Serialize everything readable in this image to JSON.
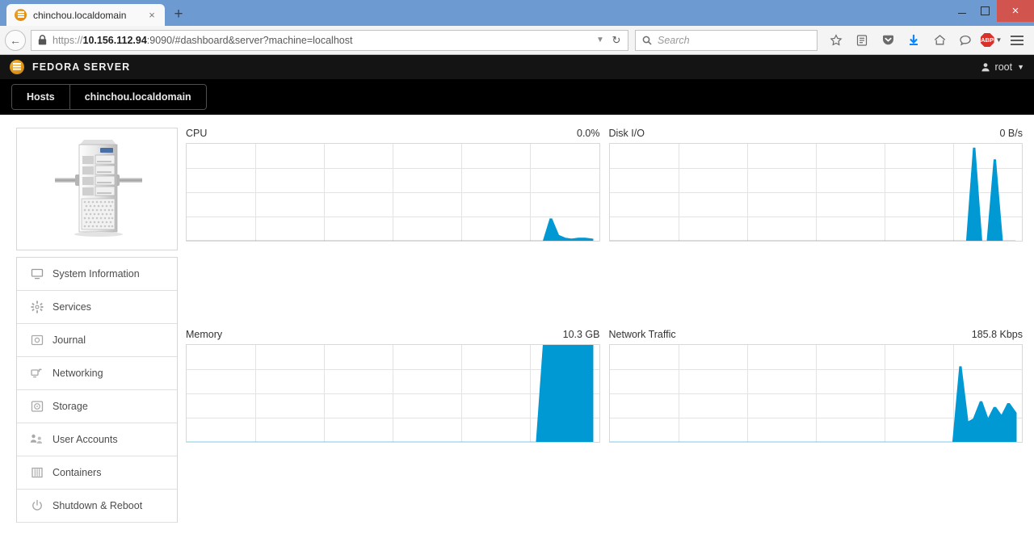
{
  "browser": {
    "tab": {
      "title": "chinchou.localdomain",
      "favicon": "fedora-icon",
      "close_label": "×"
    },
    "newtab_label": "+",
    "window_controls": {
      "minimize": "minimize-icon",
      "maximize": "restore-icon",
      "close": "×"
    },
    "url": {
      "scheme": "https://",
      "host": "10.156.112.94",
      "rest": ":9090/#dashboard&server?machine=localhost",
      "full": "https://10.156.112.94:9090/#dashboard&server?machine=localhost"
    },
    "search": {
      "placeholder": "Search"
    },
    "toolbar_icons": [
      "bookmark-star-icon",
      "reader-list-icon",
      "pocket-icon",
      "download-icon",
      "home-icon",
      "sync-chat-icon",
      "adblock-plus-icon",
      "menu-icon"
    ],
    "adblock_label": "ABP"
  },
  "app": {
    "brand": "FEDORA SERVER",
    "user": "root",
    "nav_tabs": [
      {
        "label": "Hosts"
      },
      {
        "label": "chinchou.localdomain"
      }
    ],
    "sidebar": {
      "image_name": "server-tower-illustration",
      "items": [
        {
          "label": "System Information",
          "icon": "monitor-icon"
        },
        {
          "label": "Services",
          "icon": "gear-icon"
        },
        {
          "label": "Journal",
          "icon": "journal-icon"
        },
        {
          "label": "Networking",
          "icon": "network-icon"
        },
        {
          "label": "Storage",
          "icon": "storage-disk-icon"
        },
        {
          "label": "User Accounts",
          "icon": "users-icon"
        },
        {
          "label": "Containers",
          "icon": "containers-icon"
        },
        {
          "label": "Shutdown & Reboot",
          "icon": "power-icon"
        }
      ]
    },
    "charts": [
      {
        "title": "CPU",
        "value": "0.0%"
      },
      {
        "title": "Disk I/O",
        "value": "0 B/s"
      },
      {
        "title": "Memory",
        "value": "10.3 GB"
      },
      {
        "title": "Network Traffic",
        "value": "185.8 Kbps"
      }
    ]
  },
  "colors": {
    "accent_blue": "#0099d3",
    "chart_line": "#3eaede",
    "header_black": "#141414",
    "titlebar_blue": "#6d9bd1",
    "close_red": "#d2544e"
  },
  "chart_data": [
    {
      "type": "area",
      "title": "CPU",
      "value_label": "0.0%",
      "ylabel": "",
      "xlabel": "",
      "grid": {
        "rows": 4,
        "cols": 6
      },
      "ylim": [
        0,
        100
      ],
      "x": [
        0,
        1,
        2,
        3,
        4,
        5,
        6,
        7,
        8,
        9,
        10,
        11,
        12,
        13,
        14,
        15,
        16,
        17,
        18,
        19,
        20,
        21,
        22,
        23,
        24,
        25,
        26,
        27,
        28,
        29,
        30,
        31,
        32,
        33,
        34,
        35,
        36,
        37,
        38,
        39,
        40,
        41,
        42,
        43,
        44,
        45,
        46,
        47,
        48,
        49,
        50,
        51,
        52,
        53,
        54,
        55,
        56,
        57,
        58,
        59
      ],
      "values": [
        0,
        0,
        0,
        0,
        0,
        0,
        0,
        0,
        0,
        0,
        0,
        0,
        0,
        0,
        0,
        0,
        0,
        0,
        0,
        0,
        0,
        0,
        0,
        0,
        0,
        0,
        0,
        0,
        0,
        0,
        0,
        0,
        0,
        0,
        0,
        0,
        0,
        0,
        0,
        0,
        0,
        0,
        0,
        0,
        0,
        0,
        0,
        0,
        0,
        0,
        0,
        0,
        0,
        23,
        6,
        3,
        2,
        3,
        3,
        2
      ]
    },
    {
      "type": "area",
      "title": "Disk I/O",
      "value_label": "0 B/s",
      "ylabel": "",
      "xlabel": "",
      "grid": {
        "rows": 4,
        "cols": 6
      },
      "ylim": [
        0,
        100
      ],
      "x": [
        0,
        1,
        2,
        3,
        4,
        5,
        6,
        7,
        8,
        9,
        10,
        11,
        12,
        13,
        14,
        15,
        16,
        17,
        18,
        19,
        20,
        21,
        22,
        23,
        24,
        25,
        26,
        27,
        28,
        29,
        30,
        31,
        32,
        33,
        34,
        35,
        36,
        37,
        38,
        39,
        40,
        41,
        42,
        43,
        44,
        45,
        46,
        47,
        48,
        49,
        50,
        51,
        52,
        53,
        54,
        55,
        56,
        57,
        58,
        59
      ],
      "values": [
        0,
        0,
        0,
        0,
        0,
        0,
        0,
        0,
        0,
        0,
        0,
        0,
        0,
        0,
        0,
        0,
        0,
        0,
        0,
        0,
        0,
        0,
        0,
        0,
        0,
        0,
        0,
        0,
        0,
        0,
        0,
        0,
        0,
        0,
        0,
        0,
        0,
        0,
        0,
        0,
        0,
        0,
        0,
        0,
        0,
        0,
        0,
        0,
        0,
        0,
        0,
        0,
        0,
        96,
        0,
        0,
        84,
        0,
        0,
        0
      ]
    },
    {
      "type": "area",
      "title": "Memory",
      "value_label": "10.3 GB",
      "ylabel": "",
      "xlabel": "",
      "grid": {
        "rows": 4,
        "cols": 6
      },
      "ylim": [
        0,
        100
      ],
      "x": [
        0,
        1,
        2,
        3,
        4,
        5,
        6,
        7,
        8,
        9,
        10,
        11,
        12,
        13,
        14,
        15,
        16,
        17,
        18,
        19,
        20,
        21,
        22,
        23,
        24,
        25,
        26,
        27,
        28,
        29,
        30,
        31,
        32,
        33,
        34,
        35,
        36,
        37,
        38,
        39,
        40,
        41,
        42,
        43,
        44,
        45,
        46,
        47,
        48,
        49,
        50,
        51,
        52,
        53,
        54,
        55,
        56,
        57,
        58,
        59
      ],
      "values": [
        0,
        0,
        0,
        0,
        0,
        0,
        0,
        0,
        0,
        0,
        0,
        0,
        0,
        0,
        0,
        0,
        0,
        0,
        0,
        0,
        0,
        0,
        0,
        0,
        0,
        0,
        0,
        0,
        0,
        0,
        0,
        0,
        0,
        0,
        0,
        0,
        0,
        0,
        0,
        0,
        0,
        0,
        0,
        0,
        0,
        0,
        0,
        0,
        0,
        0,
        0,
        0,
        100,
        100,
        100,
        100,
        100,
        100,
        100,
        100
      ]
    },
    {
      "type": "area",
      "title": "Network Traffic",
      "value_label": "185.8 Kbps",
      "ylabel": "",
      "xlabel": "",
      "grid": {
        "rows": 4,
        "cols": 6
      },
      "ylim": [
        0,
        100
      ],
      "x": [
        0,
        1,
        2,
        3,
        4,
        5,
        6,
        7,
        8,
        9,
        10,
        11,
        12,
        13,
        14,
        15,
        16,
        17,
        18,
        19,
        20,
        21,
        22,
        23,
        24,
        25,
        26,
        27,
        28,
        29,
        30,
        31,
        32,
        33,
        34,
        35,
        36,
        37,
        38,
        39,
        40,
        41,
        42,
        43,
        44,
        45,
        46,
        47,
        48,
        49,
        50,
        51,
        52,
        53,
        54,
        55,
        56,
        57,
        58,
        59
      ],
      "values": [
        0,
        0,
        0,
        0,
        0,
        0,
        0,
        0,
        0,
        0,
        0,
        0,
        0,
        0,
        0,
        0,
        0,
        0,
        0,
        0,
        0,
        0,
        0,
        0,
        0,
        0,
        0,
        0,
        0,
        0,
        0,
        0,
        0,
        0,
        0,
        0,
        0,
        0,
        0,
        0,
        0,
        0,
        0,
        0,
        0,
        0,
        0,
        0,
        0,
        0,
        0,
        78,
        20,
        24,
        42,
        22,
        36,
        26,
        40,
        30
      ]
    }
  ]
}
